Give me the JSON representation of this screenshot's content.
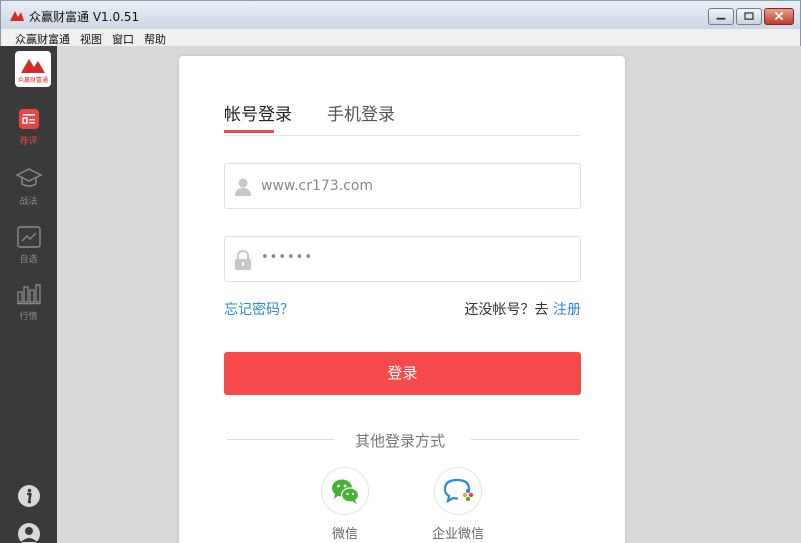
{
  "window": {
    "title": "众赢财富通 V1.0.51"
  },
  "menu": {
    "items": [
      "众赢财富通",
      "视图",
      "窗口",
      "帮助"
    ]
  },
  "sidebar": {
    "logo_text": "众赢财富通",
    "items": [
      {
        "label": "荐评",
        "icon": "calendar-icon",
        "active": true
      },
      {
        "label": "战法",
        "icon": "graduation-cap-icon",
        "active": false
      },
      {
        "label": "自选",
        "icon": "trend-chart-icon",
        "active": false
      },
      {
        "label": "行情",
        "icon": "bar-chart-icon",
        "active": false
      }
    ],
    "bottom": [
      {
        "icon": "info-icon"
      },
      {
        "icon": "user-avatar-icon"
      }
    ]
  },
  "login": {
    "tabs": [
      "帐号登录",
      "手机登录"
    ],
    "account_value": "www.cr173.com",
    "password_value": "••••••",
    "forgot_label": "忘记密码？",
    "register_prompt": "还没帐号？去",
    "register_link": "注册",
    "submit_label": "登录",
    "other_methods_label": "其他登录方式",
    "social": [
      {
        "label": "微信",
        "icon": "wechat-icon"
      },
      {
        "label": "企业微信",
        "icon": "wecom-icon"
      }
    ]
  },
  "colors": {
    "accent": "#f64949",
    "link": "#2b8ad8",
    "sidebar_bg": "#3a3a3a",
    "active_nav": "#e84545"
  }
}
